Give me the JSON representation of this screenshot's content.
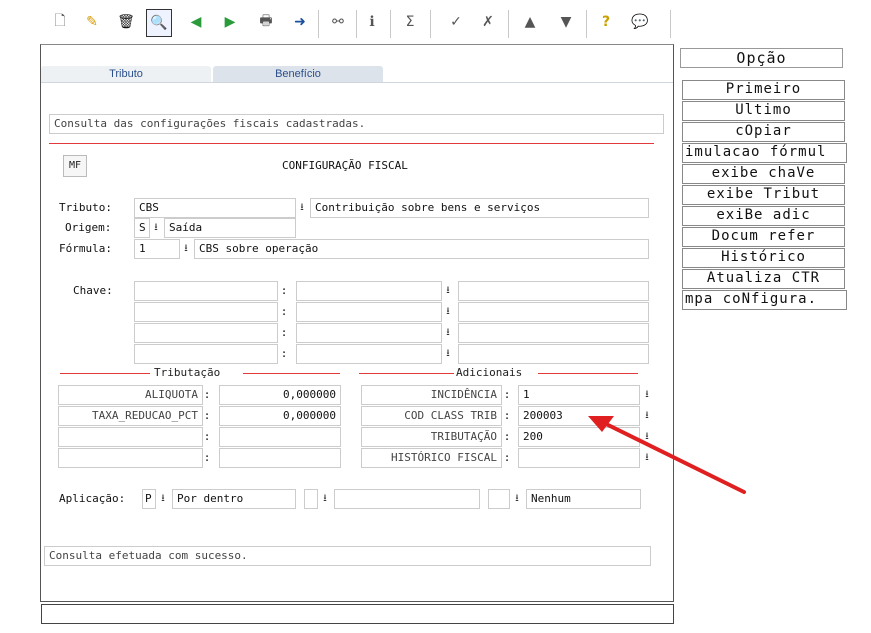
{
  "toolbar": {
    "icons": [
      "new-doc-icon",
      "edit-icon",
      "trash-icon",
      "search-icon",
      "prev-icon",
      "next-icon",
      "print-icon",
      "export-icon",
      "binoculars-icon",
      "info-icon",
      "summary-icon",
      "check-icon",
      "cancel-icon",
      "up-icon",
      "down-icon",
      "help-icon",
      "comment-icon"
    ]
  },
  "tabs": [
    "Tributo",
    "Benefício"
  ],
  "header_message": "Consulta das configurações fiscais cadastradas.",
  "mf_button": "MF",
  "section_title": "CONFIGURAÇÃO FISCAL",
  "tributo": {
    "label": "Tributo:",
    "code": "CBS",
    "desc": "Contribuição sobre bens e serviços"
  },
  "origem": {
    "label": "Origem:",
    "code": "S",
    "desc": "Saída"
  },
  "formula": {
    "label": "Fórmula:",
    "code": "1",
    "desc": "CBS sobre operação"
  },
  "chave": {
    "label": "Chave:"
  },
  "tributacao": {
    "title": "Tributação",
    "rows": [
      {
        "label": "ALIQUOTA",
        "value": "0,000000"
      },
      {
        "label": "TAXA_REDUCAO_PCT",
        "value": "0,000000"
      },
      {
        "label": "",
        "value": ""
      },
      {
        "label": "",
        "value": ""
      }
    ]
  },
  "adicionais": {
    "title": "Adicionais",
    "rows": [
      {
        "label": "INCIDÊNCIA",
        "value": "1"
      },
      {
        "label": "COD CLASS TRIB",
        "value": "200003"
      },
      {
        "label": "TRIBUTAÇÃO",
        "value": "200"
      },
      {
        "label": "HISTÓRICO FISCAL",
        "value": ""
      }
    ]
  },
  "aplicacao": {
    "label": "Aplicação:",
    "code": "P",
    "desc": "Por dentro",
    "extra": "Nenhum"
  },
  "status_message": "Consulta efetuada com sucesso.",
  "side": {
    "title": "Opção",
    "buttons": [
      "Primeiro",
      "Ultimo",
      "cOpiar",
      "imulacao fórmul",
      "exibe chaVe",
      "exibe Tribut",
      "exiBe adic",
      "Docum refer",
      "Histórico",
      "Atualiza CTR",
      "mpa coNfigura."
    ]
  },
  "arrow_color": "#e02020"
}
